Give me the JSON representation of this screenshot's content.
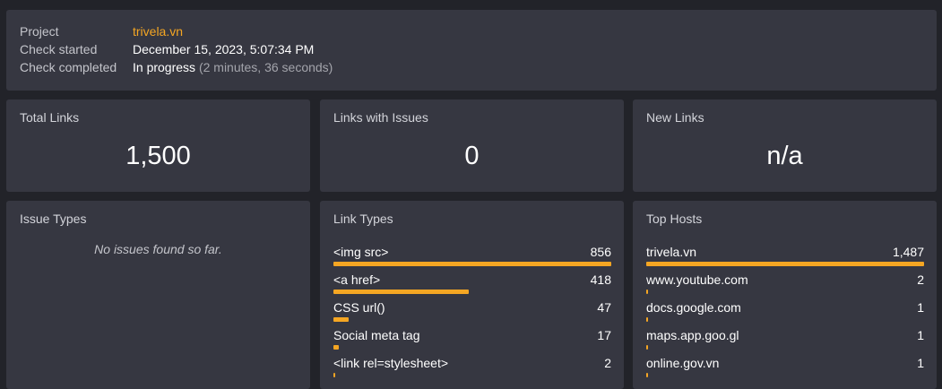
{
  "info": {
    "project_label": "Project",
    "project_value": "trivela.vn",
    "started_label": "Check started",
    "started_value": "December 15, 2023, 5:07:34 PM",
    "completed_label": "Check completed",
    "completed_value": "In progress",
    "completed_detail": "(2 minutes, 36 seconds)"
  },
  "stats": {
    "total_links": {
      "title": "Total Links",
      "value": "1,500"
    },
    "links_with_issues": {
      "title": "Links with Issues",
      "value": "0"
    },
    "new_links": {
      "title": "New Links",
      "value": "n/a"
    }
  },
  "issue_types": {
    "title": "Issue Types",
    "empty_text": "No issues found so far."
  },
  "link_types": {
    "title": "Link Types",
    "items": [
      {
        "name": "<img src>",
        "count": "856",
        "fraction": 1.0
      },
      {
        "name": "<a href>",
        "count": "418",
        "fraction": 0.488
      },
      {
        "name": "CSS url()",
        "count": "47",
        "fraction": 0.055
      },
      {
        "name": "Social meta tag",
        "count": "17",
        "fraction": 0.02
      },
      {
        "name": "<link rel=stylesheet>",
        "count": "2",
        "fraction": 0.003
      }
    ]
  },
  "top_hosts": {
    "title": "Top Hosts",
    "items": [
      {
        "name": "trivela.vn",
        "count": "1,487",
        "fraction": 1.0
      },
      {
        "name": "www.youtube.com",
        "count": "2",
        "fraction": 0.003
      },
      {
        "name": "docs.google.com",
        "count": "1",
        "fraction": 0.003
      },
      {
        "name": "maps.app.goo.gl",
        "count": "1",
        "fraction": 0.003
      },
      {
        "name": "online.gov.vn",
        "count": "1",
        "fraction": 0.003
      }
    ]
  },
  "colors": {
    "accent": "#f5a623",
    "panel": "#363741",
    "background": "#222329"
  }
}
